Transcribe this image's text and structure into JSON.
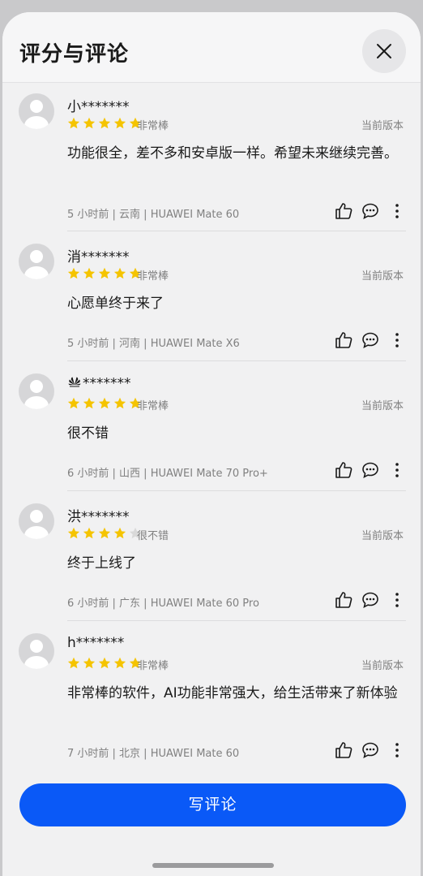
{
  "header": {
    "title": "评分与评论",
    "close_icon": "close-icon"
  },
  "reviews": [
    {
      "user": "小*******",
      "stars": 5,
      "rating_label": "非常棒",
      "version": "当前版本",
      "content": "功能很全，差不多和安卓版一样。希望未来继续完善。",
      "meta": "5 小时前 | 云南 | HUAWEI Mate 60"
    },
    {
      "user": "消*******",
      "stars": 5,
      "rating_label": "非常棒",
      "version": "当前版本",
      "content": "心愿单终于来了",
      "meta": "5 小时前 | 河南 | HUAWEI Mate X6"
    },
    {
      "user": "*******",
      "user_logo": "huawei-logo",
      "stars": 5,
      "rating_label": "非常棒",
      "version": "当前版本",
      "content": "很不错",
      "meta": "6 小时前 | 山西 | HUAWEI Mate 70 Pro+"
    },
    {
      "user": "洪*******",
      "stars": 4,
      "rating_label": "很不错",
      "version": "当前版本",
      "content": "终于上线了",
      "meta": "6 小时前 | 广东 | HUAWEI Mate 60 Pro"
    },
    {
      "user": "h*******",
      "stars": 5,
      "rating_label": "非常棒",
      "version": "当前版本",
      "content": "非常棒的软件，AI功能非常强大，给生活带来了新体验",
      "meta": "7 小时前 | 北京 | HUAWEI Mate 60"
    }
  ],
  "actions": {
    "like_icon": "thumbs-up-icon",
    "comment_icon": "comment-icon",
    "more_icon": "more-vertical-icon"
  },
  "footer": {
    "write_review_label": "写评论"
  },
  "colors": {
    "accent": "#0a59f7",
    "star_filled": "#f5c400",
    "star_empty": "#d9d9d9"
  }
}
